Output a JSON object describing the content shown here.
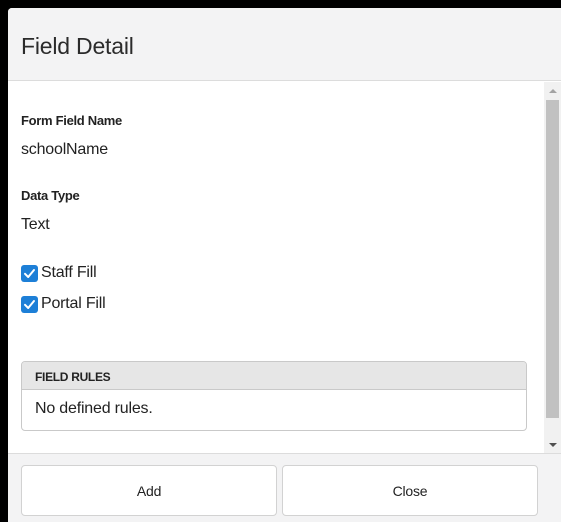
{
  "dialog": {
    "title": "Field Detail"
  },
  "fields": {
    "form_field_name": {
      "label": "Form Field Name",
      "value": "schoolName"
    },
    "data_type": {
      "label": "Data Type",
      "value": "Text"
    }
  },
  "checkboxes": [
    {
      "label": "Staff Fill",
      "checked": true,
      "icon": "checkmark-icon"
    },
    {
      "label": "Portal Fill",
      "checked": true,
      "icon": "checkmark-icon"
    }
  ],
  "field_rules": {
    "header": "FIELD RULES",
    "empty_text": "No defined rules."
  },
  "footer": {
    "add_label": "Add",
    "close_label": "Close"
  },
  "colors": {
    "checkbox_accent": "#1d7fd7",
    "header_bg": "#f3f3f4",
    "rules_header_bg": "#e6e6e6"
  }
}
